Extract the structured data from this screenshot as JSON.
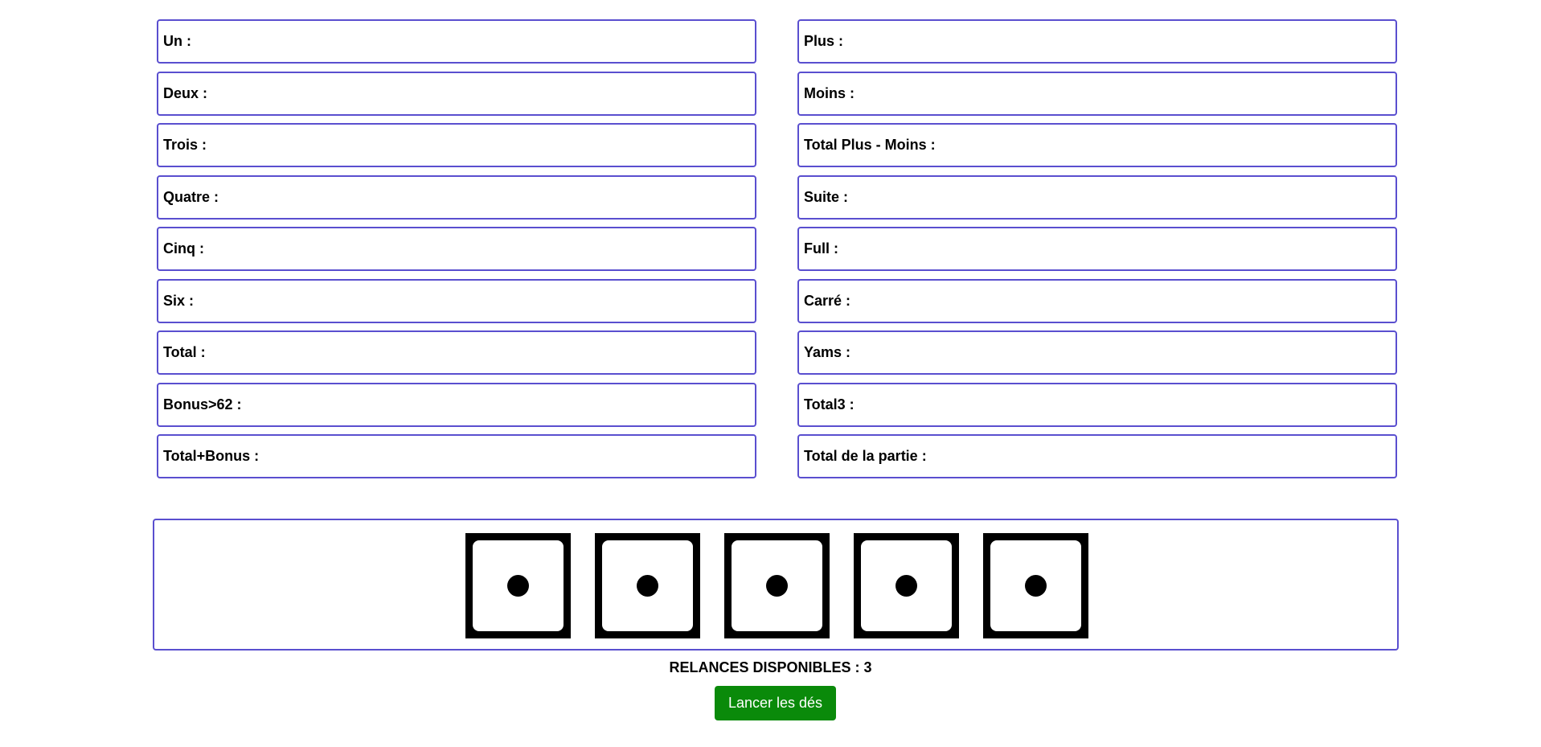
{
  "scorecard": {
    "left": [
      {
        "label": "Un :",
        "value": ""
      },
      {
        "label": "Deux :",
        "value": ""
      },
      {
        "label": "Trois :",
        "value": ""
      },
      {
        "label": "Quatre :",
        "value": ""
      },
      {
        "label": "Cinq :",
        "value": ""
      },
      {
        "label": "Six :",
        "value": ""
      },
      {
        "label": "Total :",
        "value": ""
      },
      {
        "label": "Bonus>62 :",
        "value": ""
      },
      {
        "label": "Total+Bonus :",
        "value": ""
      }
    ],
    "right": [
      {
        "label": "Plus :",
        "value": ""
      },
      {
        "label": "Moins :",
        "value": ""
      },
      {
        "label": "Total Plus - Moins :",
        "value": ""
      },
      {
        "label": "Suite :",
        "value": ""
      },
      {
        "label": "Full :",
        "value": ""
      },
      {
        "label": "Carré :",
        "value": ""
      },
      {
        "label": "Yams :",
        "value": ""
      },
      {
        "label": "Total3 :",
        "value": ""
      },
      {
        "label": "Total de la partie :",
        "value": ""
      }
    ]
  },
  "dice": [
    {
      "face": 1,
      "icon": "die-one-icon"
    },
    {
      "face": 1,
      "icon": "die-one-icon"
    },
    {
      "face": 1,
      "icon": "die-one-icon"
    },
    {
      "face": 1,
      "icon": "die-one-icon"
    },
    {
      "face": 1,
      "icon": "die-one-icon"
    }
  ],
  "controls": {
    "rerolls_text": "RELANCES DISPONIBLES : 3",
    "roll_button_label": "Lancer les dés"
  },
  "colors": {
    "border": "#5a4fcf",
    "roll_button": "#0a8a0a"
  }
}
